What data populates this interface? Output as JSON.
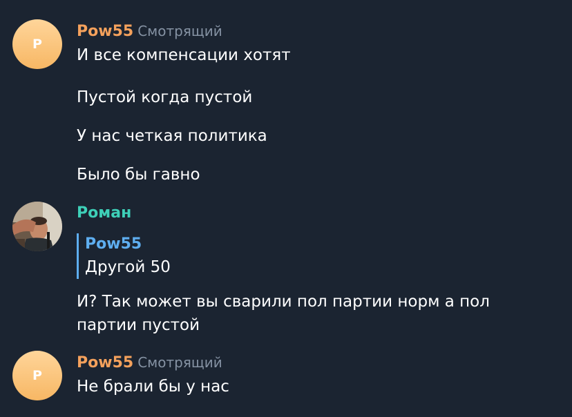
{
  "colors": {
    "background": "#1b2431",
    "orange_name": "#f4a15c",
    "teal_name": "#3ed0b8",
    "reply_accent": "#5eaef0",
    "role_gray": "#8592a3"
  },
  "messages": [
    {
      "avatar_letter": "P",
      "author": "Pow55",
      "role": "Смотрящий",
      "lines": [
        "И все компенсации хотят",
        "Пустой когда пустой",
        "У нас четкая политика",
        "Было бы гавно"
      ]
    },
    {
      "avatar": "photo-avatar",
      "author": "Роман",
      "reply": {
        "author": "Pow55",
        "text": "Другой 50"
      },
      "text": "И? Так может вы сварили пол партии норм а пол партии пустой"
    },
    {
      "avatar_letter": "P",
      "author": "Pow55",
      "role": "Смотрящий",
      "lines": [
        "Не брали бы у нас"
      ]
    }
  ]
}
